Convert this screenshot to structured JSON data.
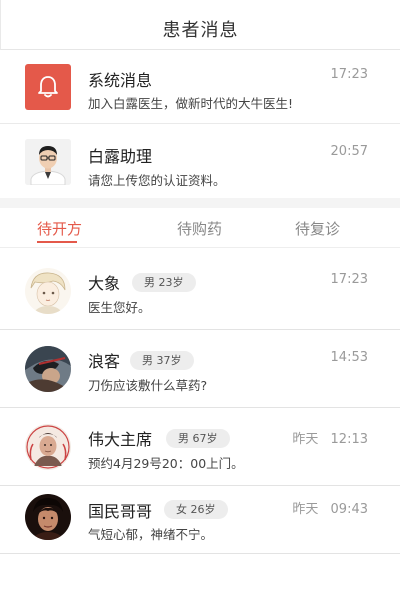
{
  "header": {
    "title": "患者消息"
  },
  "system_message": {
    "name": "系统消息",
    "text": "加入白露医生，做新时代的大牛医生!",
    "time": "17:23",
    "icon": "bell-icon",
    "icon_bg": "#e4594a"
  },
  "assistant_message": {
    "name": "白露助理",
    "text": "请您上传您的认证资料。",
    "time": "20:57"
  },
  "tabs": [
    {
      "label": "待开方",
      "active": true
    },
    {
      "label": "待购药",
      "active": false
    },
    {
      "label": "待复诊",
      "active": false
    }
  ],
  "accent_color": "#e4594a",
  "patients": [
    {
      "name": "大象",
      "badge": "男 23岁",
      "message": "医生您好。",
      "time": "17:23"
    },
    {
      "name": "浪客",
      "badge": "男 37岁",
      "message": "刀伤应该敷什么草药?",
      "time": "14:53"
    },
    {
      "name": "伟大主席",
      "badge": "男 67岁",
      "message": "预约4月29号20：00上门。",
      "time": "昨天 12:13"
    },
    {
      "name": "国民哥哥",
      "badge": "女 26岁",
      "message": "气短心郁，神绪不宁。",
      "time": "昨天 09:43"
    }
  ]
}
